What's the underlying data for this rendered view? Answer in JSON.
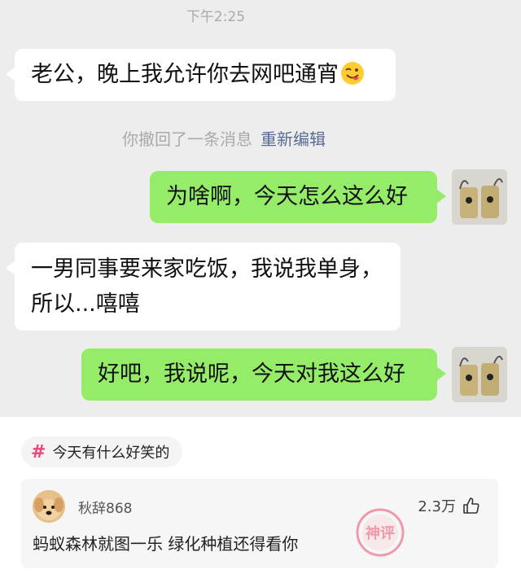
{
  "chat": {
    "time": "下午2:25",
    "messages": [
      {
        "side": "left",
        "text": "老公，晚上我允许你去网吧通宵",
        "emoji": "wink-tongue-emoji"
      },
      {
        "side": "right",
        "text": "为啥啊，今天怎么这么好"
      },
      {
        "side": "left",
        "lines": [
          "一男同事要来家吃饭，我说我单身，",
          "所以...嘻嘻"
        ]
      },
      {
        "side": "right",
        "text": "好吧，我说呢，今天对我这么好"
      }
    ],
    "recall_notice": "你撤回了一条消息",
    "recall_edit": "重新编辑"
  },
  "topic": {
    "icon": "hash-icon",
    "label": "今天有什么好笑的"
  },
  "comment": {
    "username": "秋辞868",
    "likes": "2.3万",
    "like_icon": "thumbs-up-icon",
    "text": "蚂蚁森林就图一乐 绿化种植还得看你",
    "watermark": "神评"
  },
  "colors": {
    "chat_bg": "#ededed",
    "left_bubble": "#ffffff",
    "right_bubble": "#95ec69",
    "link": "#576b95",
    "hash": "#e9467a",
    "watermark": "#e94f6a"
  }
}
